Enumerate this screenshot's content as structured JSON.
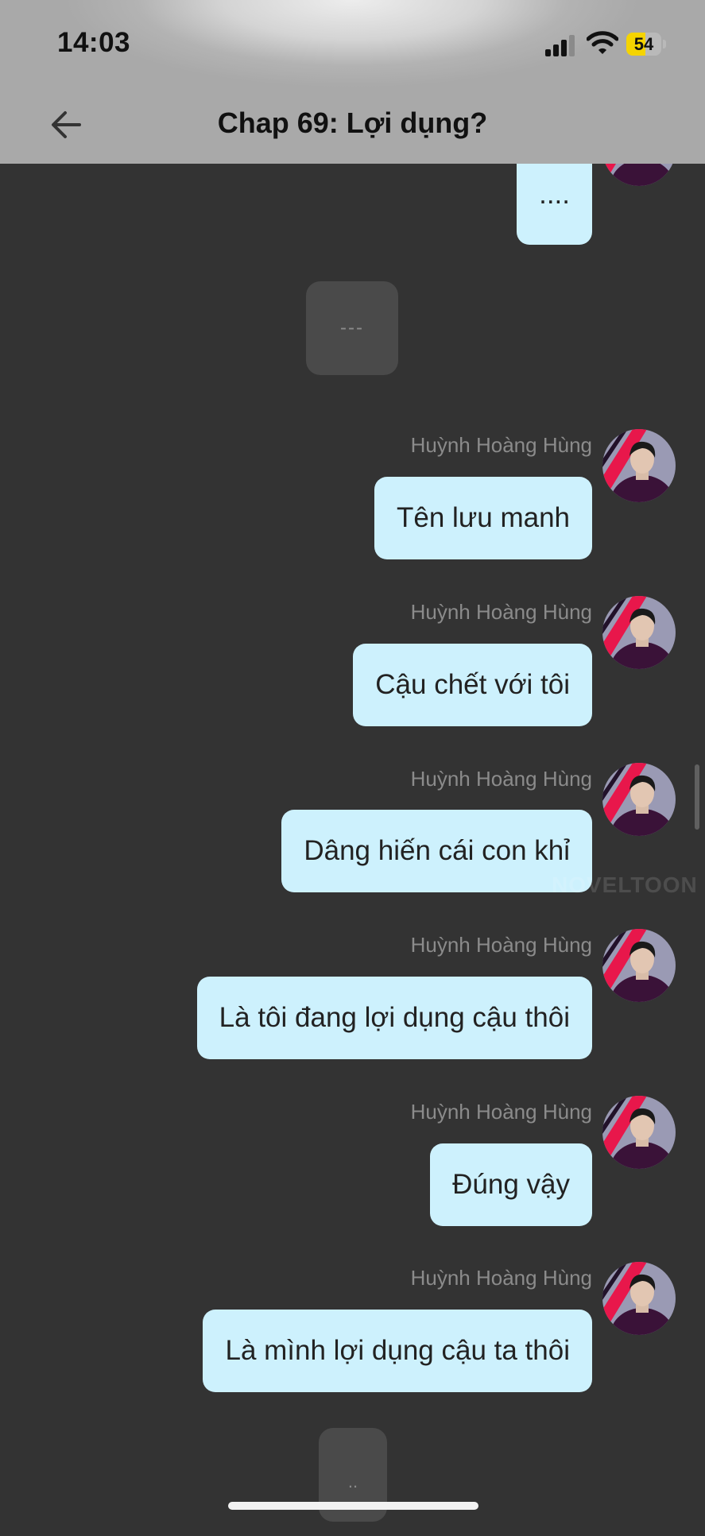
{
  "status_bar": {
    "time": "14:03",
    "battery": "54",
    "battery_level": 0.54
  },
  "header": {
    "title": "Chap 69: Lợi dụng?"
  },
  "chat": {
    "first_bubble": "....",
    "separator_top": "---",
    "messages": [
      {
        "sender": "Huỳnh Hoàng Hùng",
        "text": "Tên lưu manh"
      },
      {
        "sender": "Huỳnh Hoàng Hùng",
        "text": "Cậu chết với tôi"
      },
      {
        "sender": "Huỳnh Hoàng Hùng",
        "text": "Dâng hiến cái con khỉ"
      },
      {
        "sender": "Huỳnh Hoàng Hùng",
        "text": "Là tôi đang lợi dụng cậu thôi"
      },
      {
        "sender": "Huỳnh Hoàng Hùng",
        "text": "Đúng vậy"
      },
      {
        "sender": "Huỳnh Hoàng Hùng",
        "text": "Là mình lợi dụng cậu ta thôi"
      }
    ],
    "separator_bottom": ".."
  },
  "watermark": "NOVELTOON",
  "colors": {
    "bubble": "#cdf1fd",
    "background": "#333333",
    "sender": "#8b8b8b"
  }
}
